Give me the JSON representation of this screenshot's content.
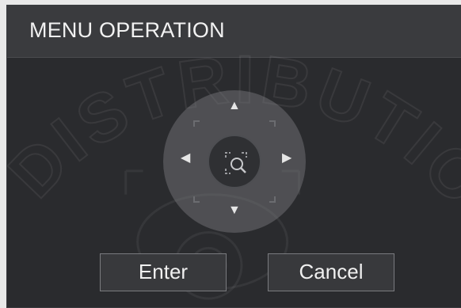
{
  "dialog": {
    "title": "MENU OPERATION",
    "enter_label": "Enter",
    "cancel_label": "Cancel"
  },
  "dpad": {
    "up": "▲",
    "down": "▼",
    "left": "◀",
    "right": "▶"
  },
  "watermark": {
    "text": "DISTRIBUTION"
  },
  "colors": {
    "background": "#2a2b2e",
    "titlebar": "#3a3b3e",
    "text": "#f2f2f2"
  }
}
